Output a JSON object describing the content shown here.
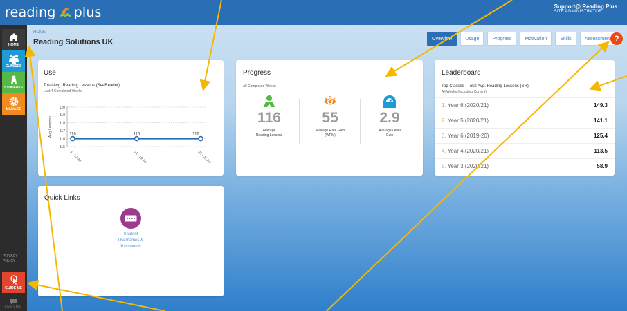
{
  "topbar": {
    "logo_text_left": "reading",
    "logo_text_right": "plus",
    "user_name": "Support@ Reading Plus",
    "user_role": "SITE ADMINISTRATOR"
  },
  "sidebar": {
    "items": [
      {
        "label": "HOME",
        "icon": "home-icon"
      },
      {
        "label": "CLASSES",
        "icon": "classes-icon"
      },
      {
        "label": "STUDENTS",
        "icon": "students-icon"
      },
      {
        "label": "MANAGE",
        "icon": "gear-icon"
      }
    ],
    "privacy_line1": "PRIVACY",
    "privacy_line2": "POLICY",
    "guide_label": "GUIDE ME",
    "chat_label": "LIVE CHAT"
  },
  "header": {
    "breadcrumb": "HOME",
    "title": "Reading Solutions UK",
    "tabs": [
      "Overview",
      "Usage",
      "Progress",
      "Motivation",
      "Skills",
      "Assessment"
    ],
    "help_label": "?"
  },
  "use_card": {
    "title": "Use",
    "subtitle": "Total Avg. Reading Lessons (SeeReader)",
    "period": "Last 4 Completed Weeks",
    "ylabel": "Avg Lessons"
  },
  "chart_data": {
    "type": "line",
    "x": [
      "6 - 12 Jul",
      "13 - 19 Jul",
      "20 - 26 Jul"
    ],
    "series": [
      {
        "values": [
          116,
          116,
          116
        ]
      }
    ],
    "y_ticks": [
      115,
      116,
      117,
      118,
      119,
      120
    ],
    "ylim": [
      115,
      120
    ],
    "data_labels": [
      "116",
      "116",
      "116"
    ],
    "ylabel": "Avg Lessons",
    "line_color": "#2a6fb5",
    "grid": true
  },
  "progress_card": {
    "title": "Progress",
    "subtitle": "All Completed Weeks",
    "metrics": [
      {
        "value": "116",
        "label1": "Average",
        "label2": "Reading Lessons",
        "icon": "student-icon",
        "color": "#56b947"
      },
      {
        "value": "55",
        "label1": "Average Rate Gain",
        "label2": "(WPM)",
        "icon": "eye-icon",
        "color": "#f28a1e"
      },
      {
        "value": "2.9",
        "label1": "Average Level",
        "label2": "Gain",
        "icon": "gauge-icon",
        "color": "#1e9bd7"
      }
    ]
  },
  "leaderboard": {
    "title": "Leaderboard",
    "subtitle": "Top Classes - Total Avg. Reading Lessons (SR)",
    "period": "All Weeks (Including Current)",
    "rows": [
      {
        "rank": "1.",
        "name": "Year 6 (2020/21)",
        "value": "149.3"
      },
      {
        "rank": "2.",
        "name": "Year 5 (2020/21)",
        "value": "141.1"
      },
      {
        "rank": "3.",
        "name": "Year 6 (2019-20)",
        "value": "125.4"
      },
      {
        "rank": "4.",
        "name": "Year 4 (2020/21)",
        "value": "113.5"
      },
      {
        "rank": "5.",
        "name": "Year 3 (2020/21)",
        "value": "58.9"
      }
    ]
  },
  "quick_links": {
    "title": "Quick Links",
    "link_line1": "Student",
    "link_line2": "Usernames &",
    "link_line3": "Passwords",
    "icon": "password-icon"
  },
  "colors": {
    "brand": "#2a6fb5",
    "annotation_arrow": "#f5b800"
  }
}
